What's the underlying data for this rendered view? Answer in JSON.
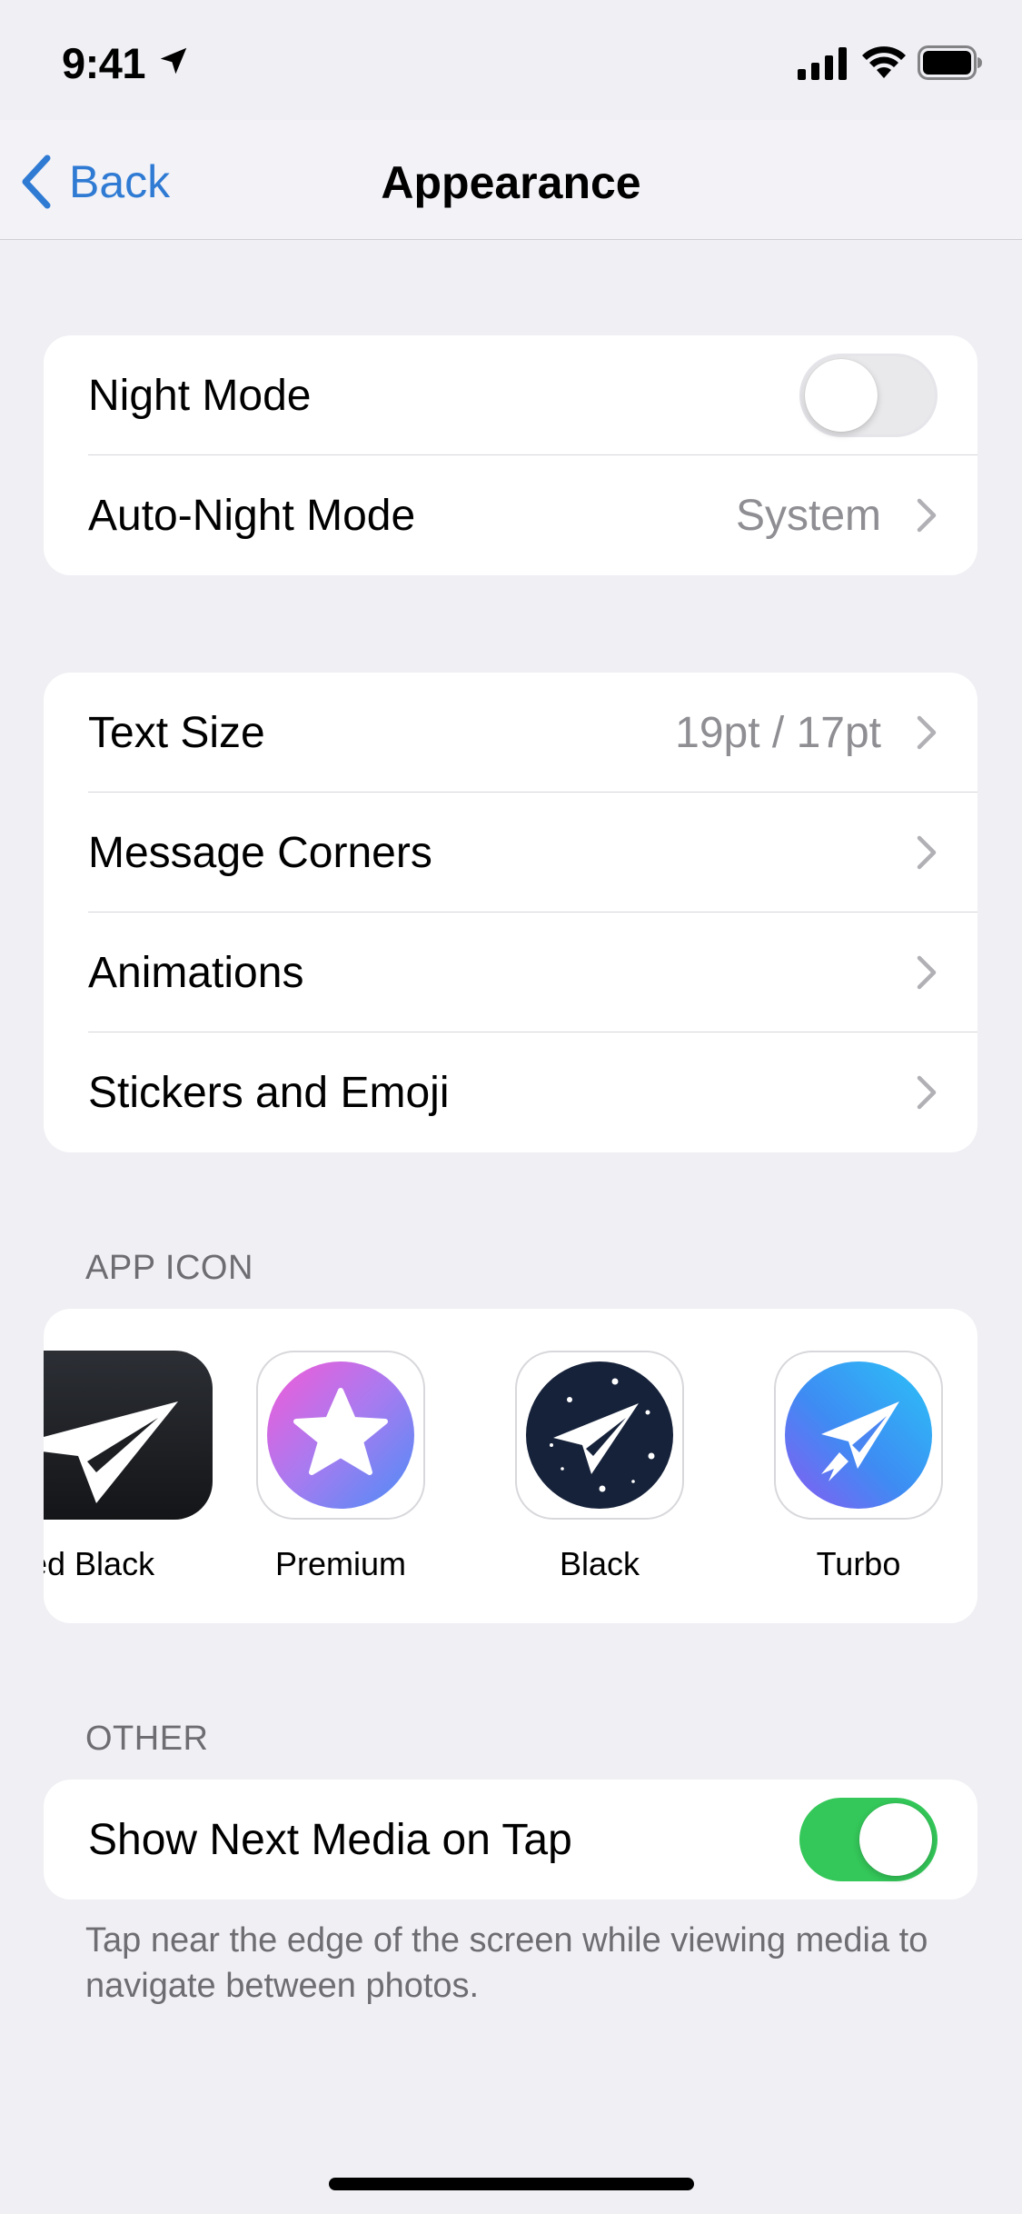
{
  "status_bar": {
    "time": "9:41"
  },
  "nav": {
    "back_label": "Back",
    "title": "Appearance"
  },
  "display_group": {
    "night_mode_label": "Night Mode",
    "night_mode_on": false,
    "auto_night_label": "Auto-Night Mode",
    "auto_night_value": "System"
  },
  "text_group": {
    "items": [
      {
        "label": "Text Size",
        "value": "19pt / 17pt"
      },
      {
        "label": "Message Corners",
        "value": ""
      },
      {
        "label": "Animations",
        "value": ""
      },
      {
        "label": "Stickers and Emoji",
        "value": ""
      }
    ]
  },
  "app_icon": {
    "header": "APP ICON",
    "icons": [
      {
        "label": "ed Black",
        "icon": "filled-black-paper-plane-icon"
      },
      {
        "label": "Premium",
        "icon": "premium-star-icon"
      },
      {
        "label": "Black",
        "icon": "black-starry-paper-plane-icon"
      },
      {
        "label": "Turbo",
        "icon": "turbo-rocket-plane-icon"
      }
    ]
  },
  "other": {
    "header": "OTHER",
    "show_next_media_label": "Show Next Media on Tap",
    "show_next_media_on": true,
    "footer": "Tap near the edge of the screen while viewing media to navigate between photos."
  },
  "colors": {
    "accent": "#2F7BD4",
    "toggle_on": "#34C759",
    "background": "#EFEFF4"
  }
}
